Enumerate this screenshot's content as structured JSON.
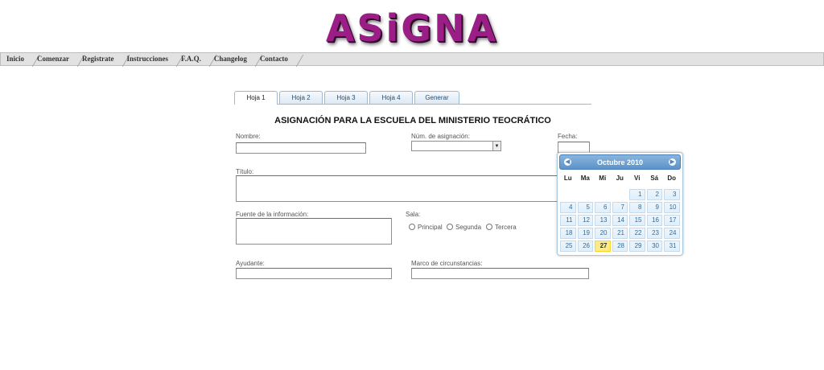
{
  "logo": "ASiGNA",
  "menu": [
    "Inicio",
    "Comenzar",
    "Registrate",
    "Instrucciones",
    "F.A.Q.",
    "Changelog",
    "Contacto"
  ],
  "tabs": [
    "Hoja 1",
    "Hoja 2",
    "Hoja 3",
    "Hoja 4",
    "Generar"
  ],
  "form": {
    "title": "ASIGNACIÓN PARA LA ESCUELA DEL MINISTERIO TEOCRÁTICO",
    "nombre_label": "Nombre:",
    "num_label": "Núm. de asignación:",
    "fecha_label": "Fecha:",
    "titulo_label": "Título:",
    "fuente_label": "Fuente de la información:",
    "sala_label": "Sala:",
    "sala_options": [
      "Principal",
      "Segunda",
      "Tercera"
    ],
    "ayudante_label": "Ayudante:",
    "marco_label": "Marco de circunstancias:"
  },
  "datepicker": {
    "month_year": "Octubre 2010",
    "prev_icon": "left-arrow-icon",
    "next_icon": "right-arrow-icon",
    "weekdays": [
      "Lu",
      "Ma",
      "Mi",
      "Ju",
      "Vi",
      "Sá",
      "Do"
    ],
    "weeks": [
      [
        "",
        "",
        "",
        "",
        "1",
        "2",
        "3"
      ],
      [
        "4",
        "5",
        "6",
        "7",
        "8",
        "9",
        "10"
      ],
      [
        "11",
        "12",
        "13",
        "14",
        "15",
        "16",
        "17"
      ],
      [
        "18",
        "19",
        "20",
        "21",
        "22",
        "23",
        "24"
      ],
      [
        "25",
        "26",
        "27",
        "28",
        "29",
        "30",
        "31"
      ]
    ],
    "highlighted_day": "27",
    "highlight_color": "#fbec88"
  }
}
